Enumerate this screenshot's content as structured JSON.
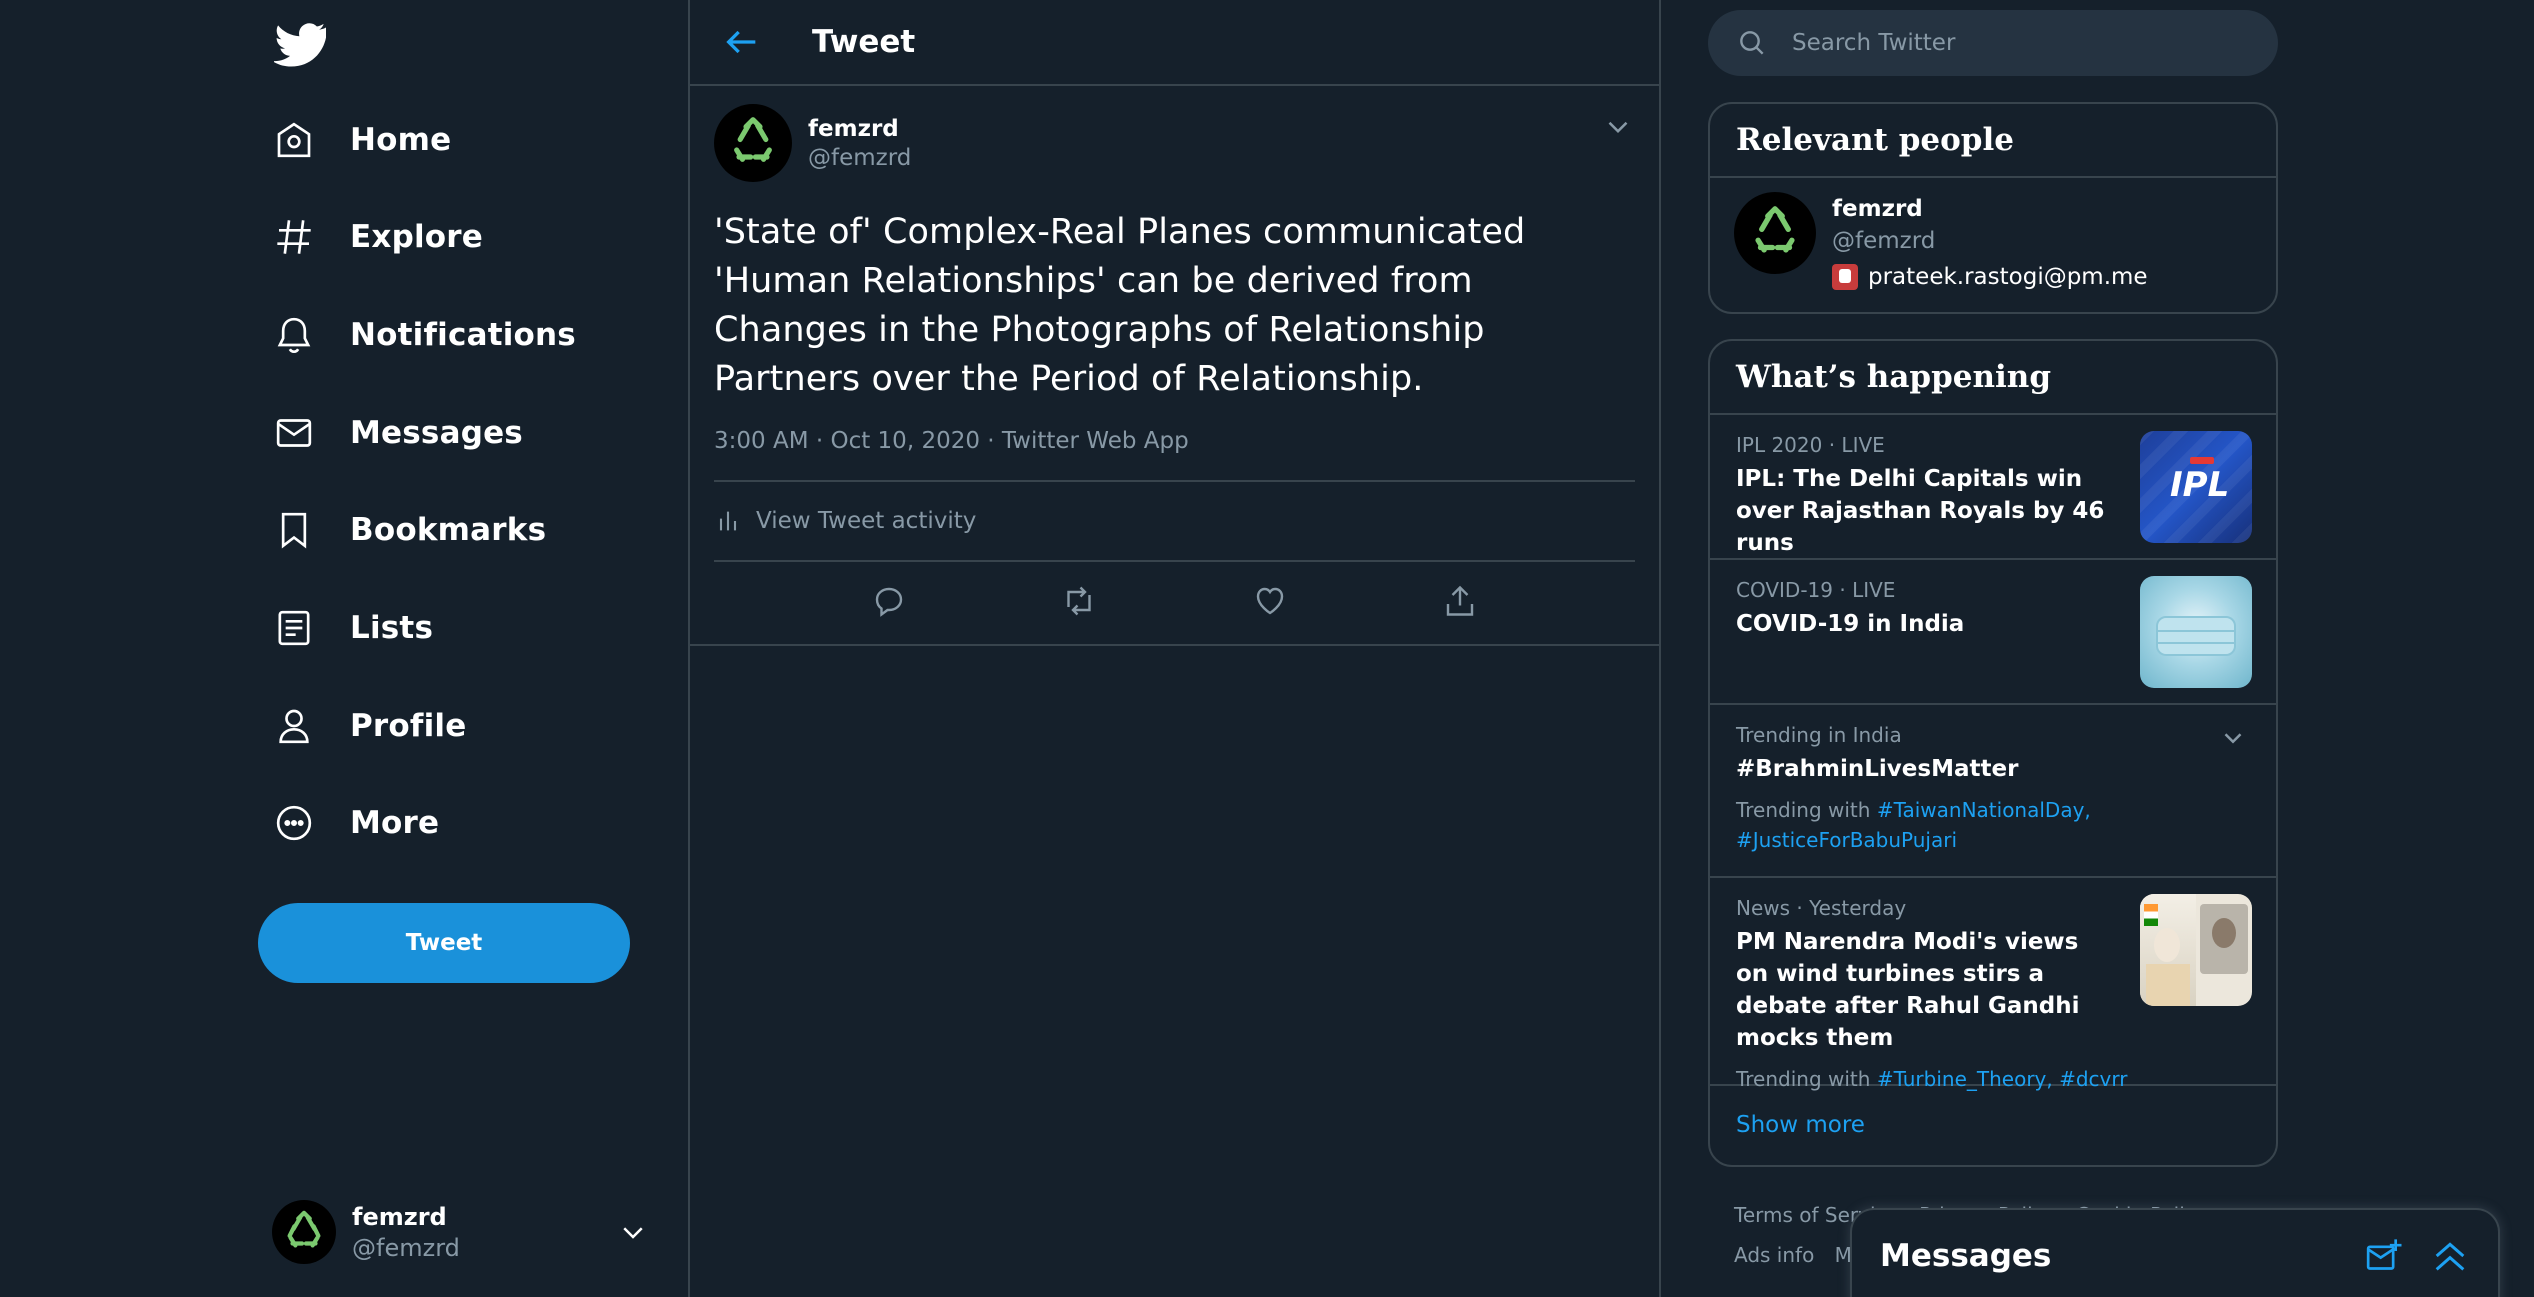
{
  "colors": {
    "background": "#15202b",
    "accent": "#1da1f2",
    "muted": "#8899a6",
    "border": "#38444d",
    "button": "#1a91da"
  },
  "nav": {
    "items": [
      {
        "label": "Home",
        "icon": "home-icon"
      },
      {
        "label": "Explore",
        "icon": "hashtag-icon"
      },
      {
        "label": "Notifications",
        "icon": "bell-icon"
      },
      {
        "label": "Messages",
        "icon": "envelope-icon"
      },
      {
        "label": "Bookmarks",
        "icon": "bookmark-icon"
      },
      {
        "label": "Lists",
        "icon": "list-icon"
      },
      {
        "label": "Profile",
        "icon": "person-icon"
      },
      {
        "label": "More",
        "icon": "more-circle-icon"
      }
    ],
    "tweet_button": "Tweet",
    "account": {
      "name": "femzrd",
      "handle": "@femzrd"
    }
  },
  "header": {
    "title": "Tweet"
  },
  "tweet": {
    "name": "femzrd",
    "handle": "@femzrd",
    "text": "'State of' Complex-Real Planes communicated 'Human Relationships' can be derived from Changes in the Photographs of Relationship Partners over the Period of Relationship.",
    "meta": "3:00 AM · Oct 10, 2020 · Twitter Web App",
    "activity": "View Tweet activity"
  },
  "search": {
    "placeholder": "Search Twitter"
  },
  "relevant": {
    "title": "Relevant people",
    "name": "femzrd",
    "handle": "@femzrd",
    "email": "prateek.rastogi@pm.me"
  },
  "happening": {
    "title": "What’s happening",
    "trends": [
      {
        "meta": "IPL 2020 · LIVE",
        "title": "IPL: The Delhi Capitals win over Rajasthan Royals by 46 runs"
      },
      {
        "meta": "COVID-19 · LIVE",
        "title": "COVID-19 in India"
      },
      {
        "meta": "Trending in India",
        "title": "#BrahminLivesMatter",
        "with_label": "Trending with",
        "tags": [
          "#TaiwanNationalDay,",
          "#JusticeForBabuPujari"
        ]
      },
      {
        "meta": "News · Yesterday",
        "title": "PM Narendra Modi's views on wind turbines stirs a debate after Rahul Gandhi mocks them",
        "with_label": "Trending with",
        "tags": [
          "#Turbine_Theory,",
          "#dcvrr"
        ]
      }
    ],
    "show_more": "Show more",
    "ipl_logo_text": "IPL"
  },
  "footer": {
    "line1": [
      "Terms of Service",
      "Privacy Policy",
      "Cookie Policy"
    ],
    "line2": [
      "Ads info",
      "Mo"
    ]
  },
  "drawer": {
    "title": "Messages"
  }
}
